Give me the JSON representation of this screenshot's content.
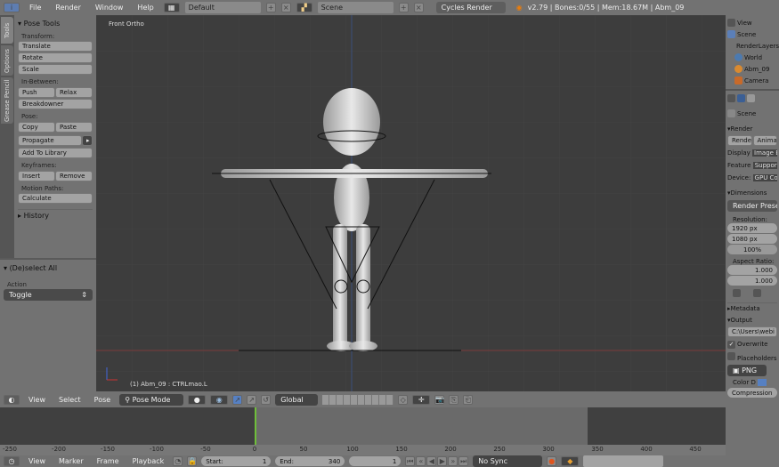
{
  "topbar": {
    "menus": [
      "File",
      "Render",
      "Window",
      "Help"
    ],
    "layout": "Default",
    "scene": "Scene",
    "engine": "Cycles Render",
    "info": "v2.79 | Bones:0/55  | Mem:18.67M | Abm_09"
  },
  "tool_tabs": [
    "Tools",
    "Options",
    "Grease Pencil"
  ],
  "pose_tools": {
    "title": "Pose Tools",
    "transform_label": "Transform:",
    "translate": "Translate",
    "rotate": "Rotate",
    "scale": "Scale",
    "inbetween_label": "In-Between:",
    "push": "Push",
    "relax": "Relax",
    "breakdowner": "Breakdowner",
    "pose_label": "Pose:",
    "copy": "Copy",
    "paste": "Paste",
    "propagate": "Propagate",
    "add_to_library": "Add To Library",
    "keyframes_label": "Keyframes:",
    "insert": "Insert",
    "remove": "Remove",
    "motion_paths_label": "Motion Paths:",
    "calculate": "Calculate",
    "history": "History"
  },
  "redo": {
    "title": "(De)select All",
    "action_label": "Action",
    "action_value": "Toggle"
  },
  "viewport": {
    "view_label": "Front Ortho",
    "status": "(1) Abm_09 : CTRLmao.L"
  },
  "view3d_header": {
    "menus": [
      "View",
      "Select",
      "Pose"
    ],
    "mode": "Pose Mode",
    "orientation": "Global"
  },
  "timeline": {
    "ticks": [
      -250,
      -200,
      -150,
      -100,
      -50,
      0,
      50,
      100,
      150,
      200,
      250,
      300,
      350,
      400,
      450
    ],
    "current_frame": 0,
    "start": 1,
    "end": 340,
    "menus": [
      "View",
      "Marker",
      "Frame",
      "Playback"
    ],
    "start_label": "Start:",
    "end_label": "End:",
    "frame": "1",
    "sync": "No Sync"
  },
  "outliner": {
    "view": "View",
    "items": [
      "Scene",
      "RenderLayers",
      "World",
      "Abm_09",
      "Camera"
    ]
  },
  "properties": {
    "scene": "Scene",
    "render_section": "Render",
    "render_btn": "Render",
    "anim_btn": "Animation",
    "display_label": "Display",
    "display_value": "Image Editor",
    "feature_label": "Feature",
    "feature_value": "Supported",
    "device_label": "Device:",
    "device_value": "GPU Compute",
    "dimensions": "Dimensions",
    "render_presets": "Render Presets",
    "resolution_label": "Resolution:",
    "res_x": "1920 px",
    "res_y": "1080 px",
    "res_pct": "100%",
    "aspect_label": "Aspect Ratio:",
    "aspect_x": "1.000",
    "aspect_y": "1.000",
    "metadata": "Metadata",
    "output": "Output",
    "output_path": "C:\\Users\\webi",
    "overwrite": "Overwrite",
    "placeholders": "Placeholders",
    "format": "PNG",
    "color_depth_label": "Color D",
    "compression": "Compression"
  },
  "colors": {
    "accent": "#5680c2",
    "frame_marker": "#6fbf3a"
  }
}
